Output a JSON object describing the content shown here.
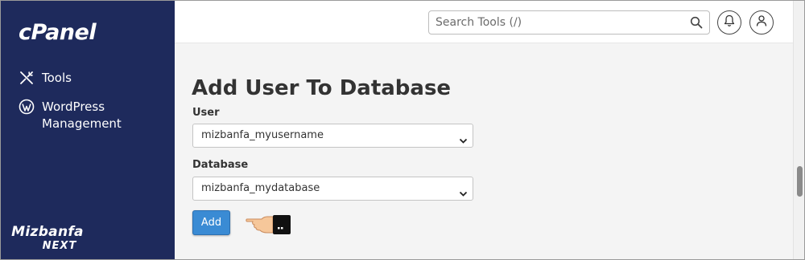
{
  "sidebar": {
    "logo": "cPanel",
    "items": [
      {
        "label": "Tools",
        "icon": "tools-icon"
      },
      {
        "label": "WordPress Management",
        "icon": "wordpress-icon",
        "line1": "WordPress",
        "line2": "Management"
      }
    ],
    "brand": {
      "line1": "Mizbanfa",
      "line2": "NEXT"
    }
  },
  "header": {
    "search_placeholder": "Search Tools (/)",
    "icons": [
      "search-icon",
      "bell-icon",
      "user-icon"
    ]
  },
  "main": {
    "title": "Add User To Database",
    "user_label": "User",
    "user_value": "mizbanfa_myusername",
    "database_label": "Database",
    "database_value": "mizbanfa_mydatabase",
    "add_label": "Add"
  },
  "colors": {
    "sidebar_bg": "#1e2a5c",
    "button": "#3a8bd4",
    "page_bg": "#f4f4f4"
  }
}
